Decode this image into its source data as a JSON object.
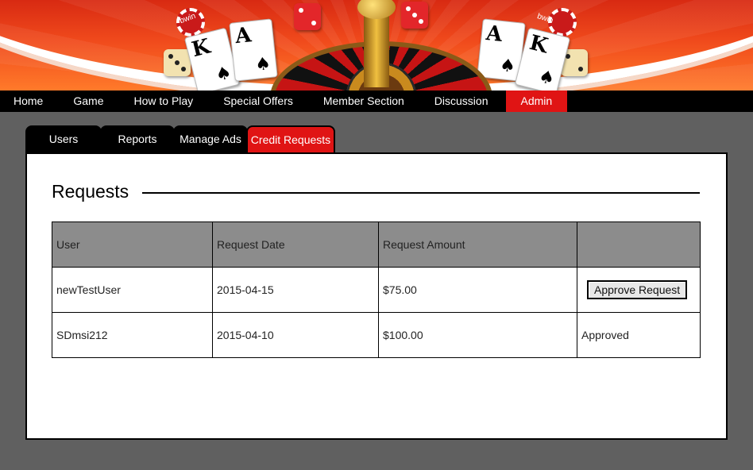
{
  "banner": {
    "brand_left": "bwin",
    "brand_right": "bwin",
    "card_rank_k": "K",
    "card_rank_a": "A",
    "card_suit": "♠"
  },
  "nav": {
    "items": [
      "Home",
      "Game",
      "How to Play",
      "Special Offers",
      "Member Section",
      "Discussion",
      "Admin"
    ],
    "active": "Admin",
    "active_color": "#e01414"
  },
  "tabs": {
    "items": [
      "Users",
      "Reports",
      "Manage Ads",
      "Credit Requests"
    ],
    "active": "Credit Requests"
  },
  "main": {
    "heading": "Requests",
    "table": {
      "headers": [
        "User",
        "Request Date",
        "Request Amount",
        ""
      ],
      "rows": [
        {
          "user": "newTestUser",
          "date": "2015-04-15",
          "amount": "$75.00",
          "action_label": "Approve Request",
          "status": ""
        },
        {
          "user": "SDmsi212",
          "date": "2015-04-10",
          "amount": "$100.00",
          "action_label": "",
          "status": "Approved"
        }
      ]
    }
  }
}
